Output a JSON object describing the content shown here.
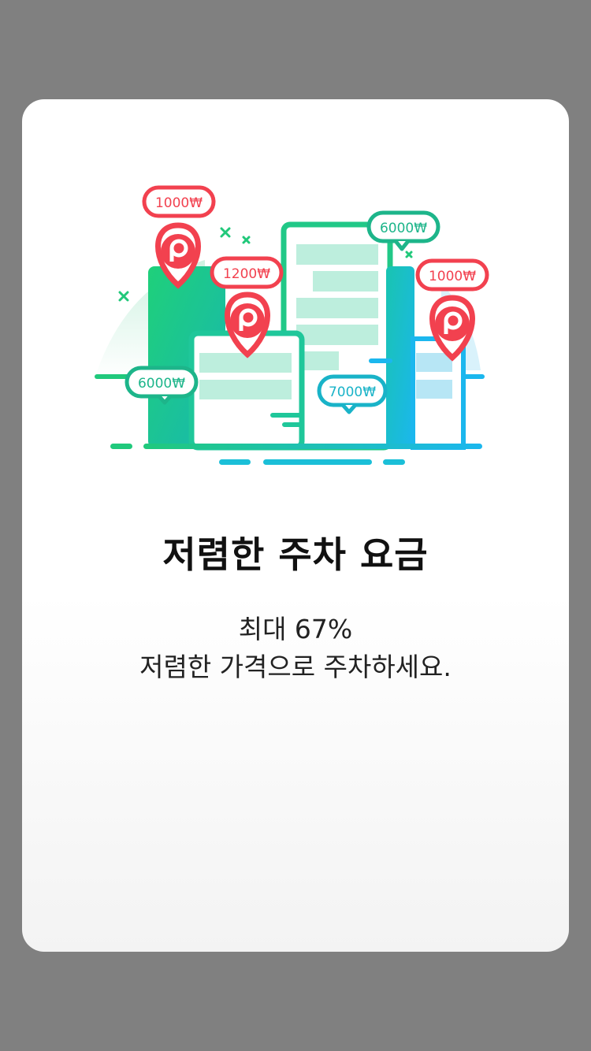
{
  "illustration": {
    "price_tags": [
      {
        "label": "1000₩",
        "color": "#f2414f"
      },
      {
        "label": "1200₩",
        "color": "#f2414f"
      },
      {
        "label": "6000₩",
        "color": "#1db58a"
      },
      {
        "label": "6000₩",
        "color": "#1db58a"
      },
      {
        "label": "7000₩",
        "color": "#19b3c8"
      },
      {
        "label": "1000₩",
        "color": "#f2414f"
      }
    ],
    "pin_icon": "parking-location-pin-icon",
    "accent_green": "#21c87a",
    "accent_blue": "#1bb7ee",
    "accent_red": "#f2414f"
  },
  "onboarding": {
    "title": "저렴한 주차 요금",
    "line1": "최대 67%",
    "line2": "저렴한 가격으로 주차하세요."
  }
}
